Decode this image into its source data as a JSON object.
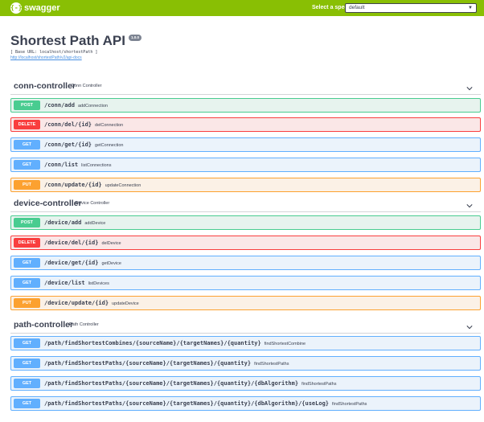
{
  "topbar": {
    "logo_glyph": "{-}",
    "logo_text": "swagger",
    "spec_label": "Select a spec",
    "spec_value": "default",
    "color": "#89bf04"
  },
  "info": {
    "title": "Shortest Path API",
    "version": "1.0.0",
    "base_url": "[ Base URL: localhost/shortestPath ]",
    "docs_link": "http://localhost/shortestPath/v2/api-docs"
  },
  "sections": [
    {
      "name": "conn-controller",
      "description": "Conn Controller",
      "operations": [
        {
          "method": "POST",
          "path": "/conn/add",
          "summary": "addConnection"
        },
        {
          "method": "DELETE",
          "path": "/conn/del/{id}",
          "summary": "delConnection"
        },
        {
          "method": "GET",
          "path": "/conn/get/{id}",
          "summary": "getConnection"
        },
        {
          "method": "GET",
          "path": "/conn/list",
          "summary": "listConnections"
        },
        {
          "method": "PUT",
          "path": "/conn/update/{id}",
          "summary": "updateConnection"
        }
      ]
    },
    {
      "name": "device-controller",
      "description": "Device Controller",
      "operations": [
        {
          "method": "POST",
          "path": "/device/add",
          "summary": "addDevice"
        },
        {
          "method": "DELETE",
          "path": "/device/del/{id}",
          "summary": "delDevice"
        },
        {
          "method": "GET",
          "path": "/device/get/{id}",
          "summary": "getDevice"
        },
        {
          "method": "GET",
          "path": "/device/list",
          "summary": "listDevices"
        },
        {
          "method": "PUT",
          "path": "/device/update/{id}",
          "summary": "updateDevice"
        }
      ]
    },
    {
      "name": "path-controller",
      "description": "Path Controller",
      "operations": [
        {
          "method": "GET",
          "path": "/path/findShortestCombines/{sourceName}/{targetNames}/{quantity}",
          "summary": "findShortestCombine"
        },
        {
          "method": "GET",
          "path": "/path/findShortestPaths/{sourceName}/{targetNames}/{quantity}",
          "summary": "findShortestPaths"
        },
        {
          "method": "GET",
          "path": "/path/findShortestPaths/{sourceName}/{targetNames}/{quantity}/{dbAlgorithm}",
          "summary": "findShortestPaths"
        },
        {
          "method": "GET",
          "path": "/path/findShortestPaths/{sourceName}/{targetNames}/{quantity}/{dbAlgorithm}/{useLog}",
          "summary": "findShortestPaths"
        }
      ]
    }
  ]
}
